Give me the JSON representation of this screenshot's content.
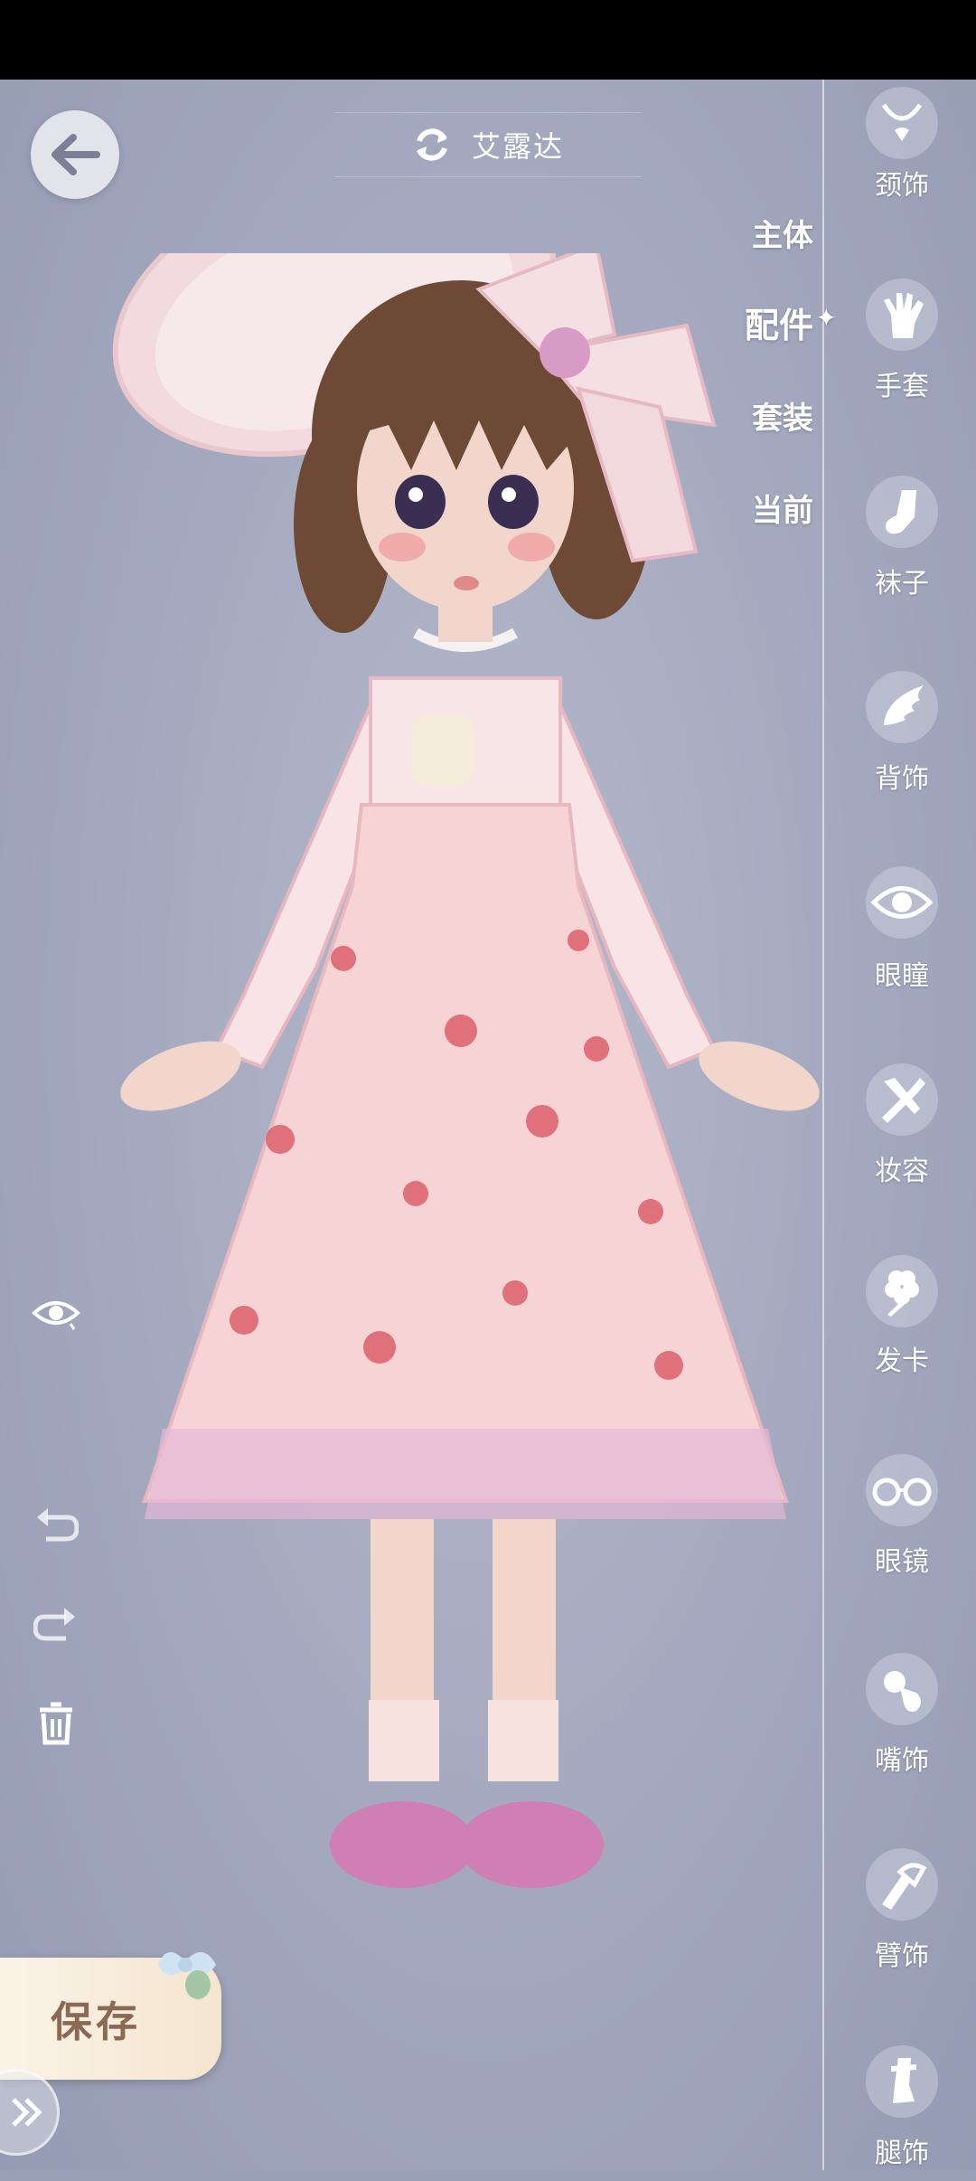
{
  "header": {
    "character_name": "艾露达"
  },
  "category_tabs": [
    {
      "label": "主体",
      "active": false
    },
    {
      "label": "配件",
      "active": true
    },
    {
      "label": "套装",
      "active": false
    },
    {
      "label": "当前",
      "active": false
    }
  ],
  "accessories": [
    {
      "label": "颈饰",
      "icon": "necklace-icon"
    },
    {
      "label": "手套",
      "icon": "glove-icon"
    },
    {
      "label": "袜子",
      "icon": "sock-icon"
    },
    {
      "label": "背饰",
      "icon": "wing-icon"
    },
    {
      "label": "眼瞳",
      "icon": "eye-icon"
    },
    {
      "label": "妆容",
      "icon": "makeup-brush-icon"
    },
    {
      "label": "发卡",
      "icon": "hairclip-icon"
    },
    {
      "label": "眼镜",
      "icon": "glasses-icon"
    },
    {
      "label": "嘴饰",
      "icon": "pacifier-icon"
    },
    {
      "label": "臂饰",
      "icon": "armband-icon"
    },
    {
      "label": "腿饰",
      "icon": "leg-ornament-icon"
    }
  ],
  "actions": {
    "save_label": "保存"
  },
  "colors": {
    "accent": "#8a6a55",
    "background": "#a3a8be",
    "dress_pink": "#f6d3d5",
    "dot_red": "#e0707a"
  }
}
